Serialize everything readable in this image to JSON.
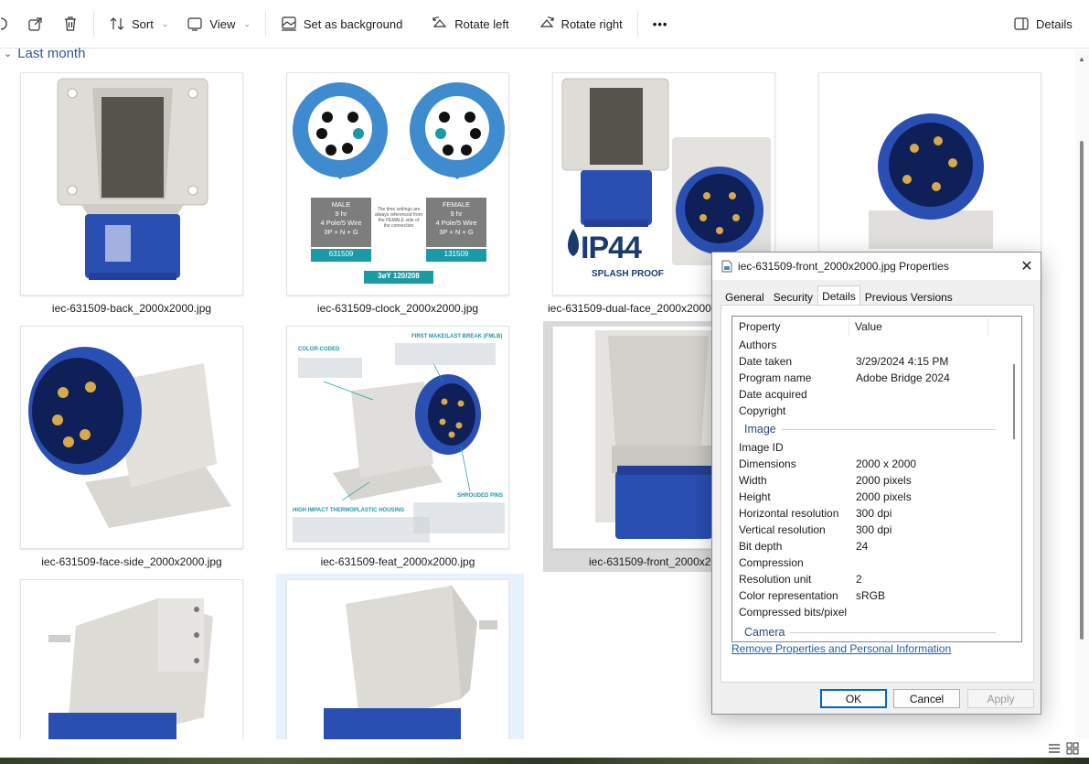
{
  "toolbar": {
    "sort": "Sort",
    "view": "View",
    "set_background": "Set as background",
    "rotate_left": "Rotate left",
    "rotate_right": "Rotate right",
    "more": "•••",
    "details": "Details"
  },
  "group": {
    "title": "Last month"
  },
  "files": [
    {
      "name": "iec-631509-back_2000x2000.jpg"
    },
    {
      "name": "iec-631509-clock_2000x2000.jpg"
    },
    {
      "name": "iec-631509-dual-face_2000x2000.jpg"
    },
    {
      "name": ""
    },
    {
      "name": "iec-631509-face-side_2000x2000.jpg"
    },
    {
      "name": "iec-631509-feat_2000x2000.jpg"
    },
    {
      "name": "iec-631509-front_2000x2000.jpg"
    }
  ],
  "clock_image": {
    "male_title": "MALE",
    "male_hr": "9 hr",
    "male_wire": "4 Pole/5 Wire",
    "male_spec": "3P + N + G",
    "male_part": "631509",
    "female_title": "FEMALE",
    "female_hr": "9 hr",
    "female_wire": "4 Pole/5 Wire",
    "female_spec": "3P + N + G",
    "female_part": "131509",
    "note": "The time settings are always referenced from the FEMALE side of the connection",
    "voltage": "3øY 120/208"
  },
  "dual_image": {
    "rating": "IP44",
    "splash": "SPLASH PROOF"
  },
  "feat_image": {
    "color_coded": "COLOR-CODED",
    "first_make": "FIRST MAKE/LAST BREAK (FMLB)",
    "shrouded": "SHROUDED PINS",
    "housing": "HIGH IMPACT THERMOPLASTIC HOUSING"
  },
  "dialog": {
    "title": "iec-631509-front_2000x2000.jpg Properties",
    "tabs": [
      "General",
      "Security",
      "Details",
      "Previous Versions"
    ],
    "col_property": "Property",
    "col_value": "Value",
    "rows_top": [
      {
        "k": "Authors",
        "v": ""
      },
      {
        "k": "Date taken",
        "v": "3/29/2024 4:15 PM"
      },
      {
        "k": "Program name",
        "v": "Adobe Bridge 2024"
      },
      {
        "k": "Date acquired",
        "v": ""
      },
      {
        "k": "Copyright",
        "v": ""
      }
    ],
    "section_image": "Image",
    "rows_image": [
      {
        "k": "Image ID",
        "v": ""
      },
      {
        "k": "Dimensions",
        "v": "2000 x 2000"
      },
      {
        "k": "Width",
        "v": "2000 pixels"
      },
      {
        "k": "Height",
        "v": "2000 pixels"
      },
      {
        "k": "Horizontal resolution",
        "v": "300 dpi"
      },
      {
        "k": "Vertical resolution",
        "v": "300 dpi"
      },
      {
        "k": "Bit depth",
        "v": "24"
      },
      {
        "k": "Compression",
        "v": ""
      },
      {
        "k": "Resolution unit",
        "v": "2"
      },
      {
        "k": "Color representation",
        "v": "sRGB"
      },
      {
        "k": "Compressed bits/pixel",
        "v": ""
      }
    ],
    "section_camera": "Camera",
    "remove_link": "Remove Properties and Personal Information",
    "ok": "OK",
    "cancel": "Cancel",
    "apply": "Apply"
  },
  "colors": {
    "accent": "#0067c0",
    "plug_blue": "#2a4fb3",
    "teal": "#1a9aa5",
    "housing_grey": "#dcdcd8"
  }
}
